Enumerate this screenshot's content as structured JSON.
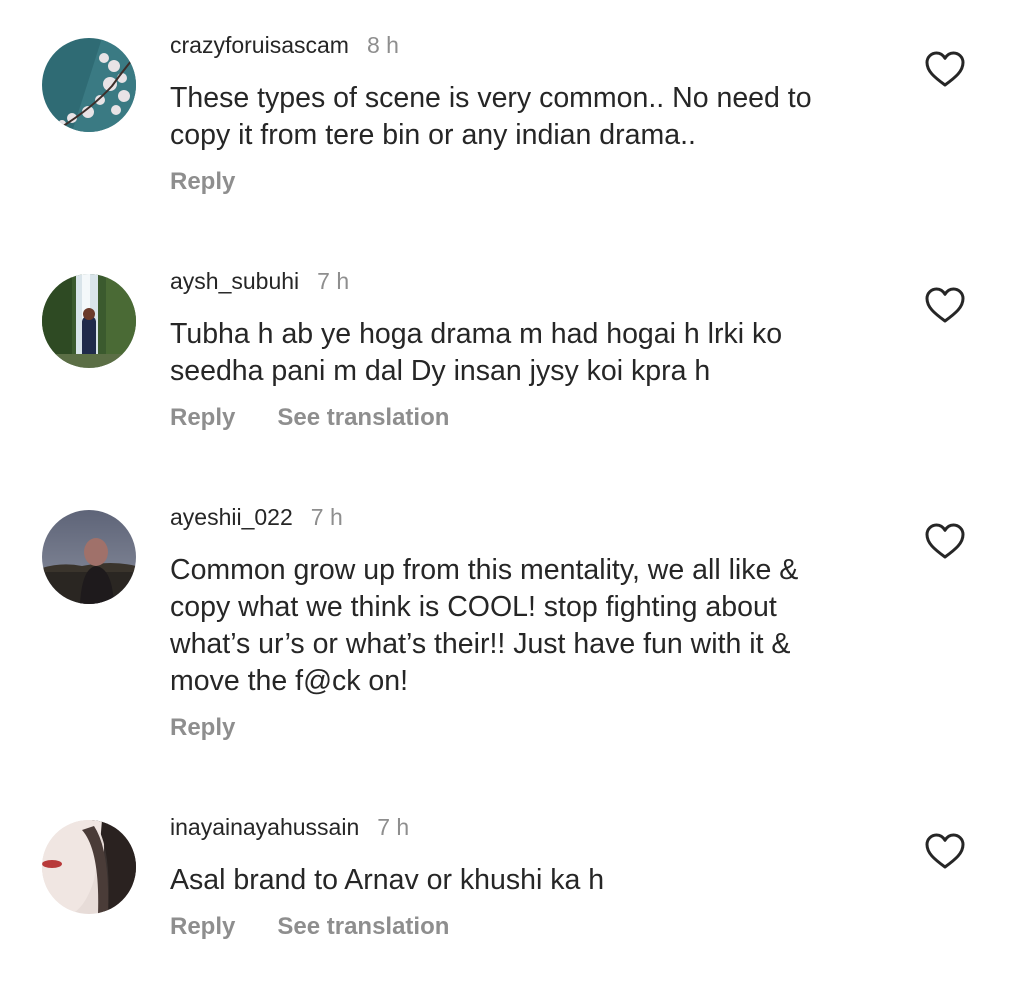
{
  "comments": [
    {
      "username": "crazyforuisascam",
      "time": "8 h",
      "text": "These types of scene is very common.. No need to\ncopy it from tere bin or any indian drama..",
      "reply_label": "Reply",
      "translation_label": ""
    },
    {
      "username": "aysh_subuhi",
      "time": "7 h",
      "text": "Tubha h ab ye hoga drama m had hogai h lrki ko\nseedha pani m dal Dy insan jysy koi kpra h",
      "reply_label": "Reply",
      "translation_label": "See translation"
    },
    {
      "username": "ayeshii_022",
      "time": "7 h",
      "text": "Common grow up from this mentality, we all like &\ncopy what we think is COOL!  stop fighting about\nwhat’s ur’s or what’s their!! Just have fun with it &\nmove the f@ck on!",
      "reply_label": "Reply",
      "translation_label": ""
    },
    {
      "username": "inayainayahussain",
      "time": "7 h",
      "text": "Asal brand to Arnav or khushi ka h",
      "reply_label": "Reply",
      "translation_label": "See translation"
    }
  ],
  "icons": {
    "like": "heart-outline-icon"
  },
  "colors": {
    "text": "#262626",
    "secondary": "#8e8e8e"
  }
}
